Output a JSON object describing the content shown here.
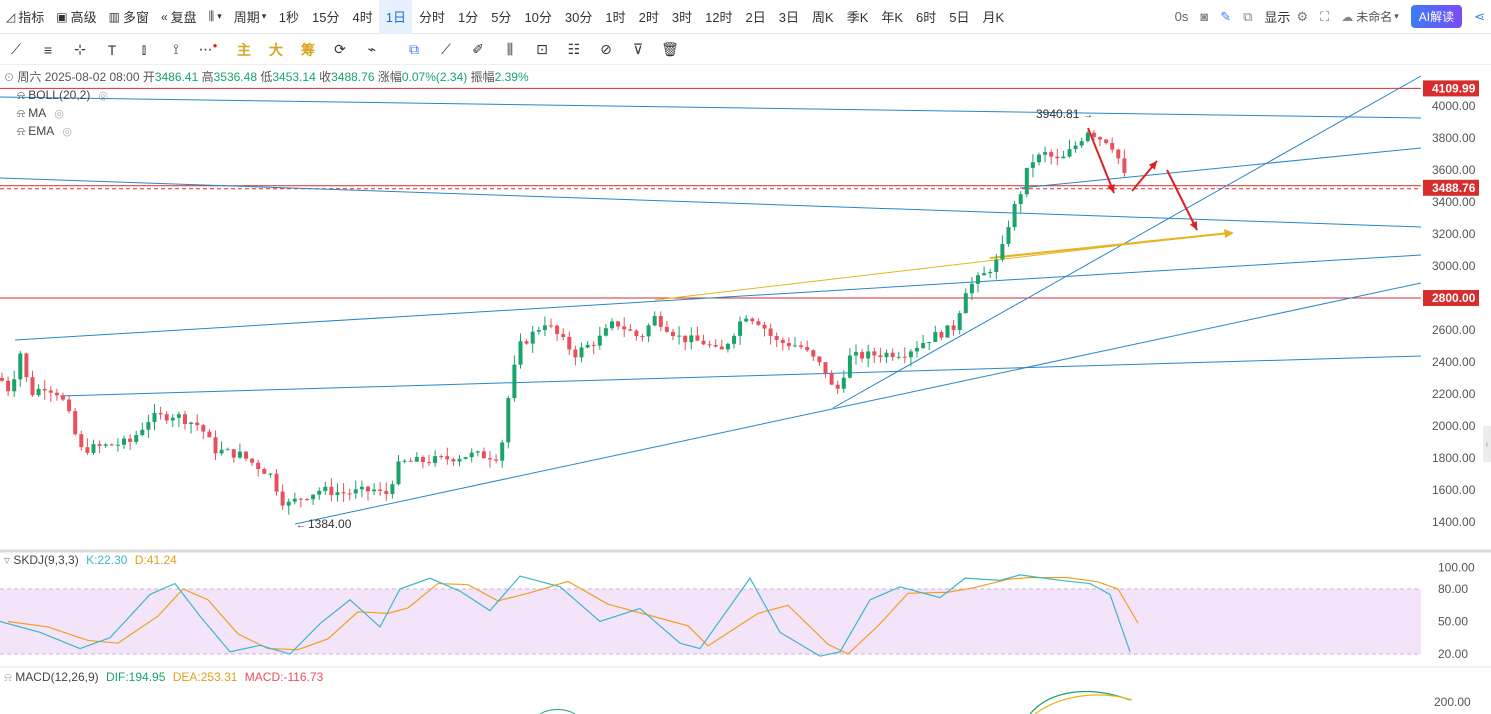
{
  "toolbar": {
    "indicator": "指标",
    "advanced": "高级",
    "multi_window": "多窗",
    "replay": "复盘",
    "chart_type_icon": "candlestick-icon",
    "period_menu": "周期",
    "periods": [
      "1秒",
      "15分",
      "4时",
      "1日",
      "分时",
      "1分",
      "5分",
      "10分",
      "30分",
      "1时",
      "2时",
      "3时",
      "12时",
      "2日",
      "3日",
      "周K",
      "季K",
      "年K",
      "6时",
      "5日",
      "月K"
    ],
    "active_period": "1日",
    "latency": "0s",
    "display": "显示",
    "unnamed": "未命名",
    "ai_button": "AI解读"
  },
  "drawing_tools": {
    "gold_labels": [
      "主",
      "大",
      "筹"
    ]
  },
  "info": {
    "date": "周六 2025-08-02 08:00",
    "open_label": "开",
    "open": "3486.41",
    "high_label": "高",
    "high": "3536.48",
    "low_label": "低",
    "low": "3453.14",
    "close_label": "收",
    "close": "3488.76",
    "change_label": "涨幅",
    "change": "0.07%(2.34)",
    "amplitude_label": "振幅",
    "amplitude": "2.39%"
  },
  "indicators": {
    "boll": "BOLL(20,2)",
    "ma": "MA",
    "ema": "EMA"
  },
  "price_tags": {
    "resistance": "4109.99",
    "current": "3488.76",
    "support": "2800.00"
  },
  "annotations": {
    "high_marker": "3940.81",
    "low_marker": "1384.00"
  },
  "skdj": {
    "name": "SKDJ(9,3,3)",
    "k_label": "K:22.30",
    "d_label": "D:41.24"
  },
  "macd": {
    "name": "MACD(12,26,9)",
    "dif_label": "DIF:194.95",
    "dea_label": "DEA:253.31",
    "macd_label": "MACD:-116.73"
  },
  "colors": {
    "up": "#1aa36a",
    "down": "#e8505b",
    "trend_line": "#2a86c8",
    "red_line": "#d62d2d",
    "gold_line": "#e6b422",
    "arrow": "#e02020",
    "k_line": "#3db7c8",
    "d_line": "#f0a020",
    "kdj_band": "#f3e4fa"
  },
  "chart_data": {
    "type": "candlestick",
    "y_axis_ticks": [
      4000,
      3800,
      3600,
      3400,
      3200,
      3000,
      2800,
      2600,
      2400,
      2200,
      2000,
      1800,
      1600,
      1400
    ],
    "ylim": [
      1300,
      4200
    ],
    "high": 3940.81,
    "low": 1384.0,
    "horizontal_levels": [
      4109.99,
      3488.76,
      2800.0
    ],
    "skdj_ticks": [
      100,
      80,
      50,
      20
    ],
    "macd_ticks": [
      200
    ]
  }
}
